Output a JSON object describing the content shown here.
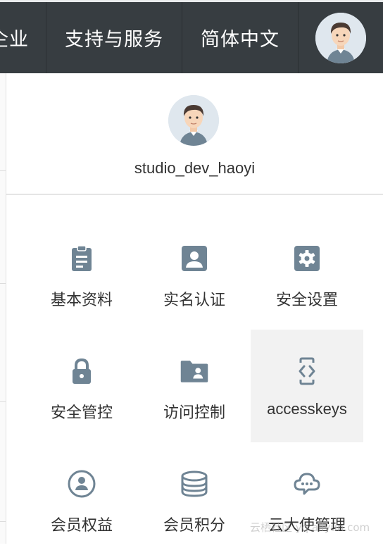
{
  "topbar": {
    "enterprise_label": "企业",
    "support_label": "支持与服务",
    "language_label": "简体中文",
    "avatar_icon": "user-avatar"
  },
  "profile": {
    "username": "studio_dev_haoyi",
    "avatar_icon": "user-avatar"
  },
  "menu": {
    "items": [
      {
        "label": "基本资料",
        "icon": "clipboard-icon"
      },
      {
        "label": "实名认证",
        "icon": "id-card-icon"
      },
      {
        "label": "安全设置",
        "icon": "gear-icon"
      },
      {
        "label": "安全管控",
        "icon": "lock-icon"
      },
      {
        "label": "访问控制",
        "icon": "folder-user-icon"
      },
      {
        "label": "accesskeys",
        "icon": "code-brackets-icon"
      },
      {
        "label": "会员权益",
        "icon": "member-badge-icon"
      },
      {
        "label": "会员积分",
        "icon": "coin-stack-icon"
      },
      {
        "label": "云大使管理",
        "icon": "cloud-chat-icon"
      }
    ],
    "active_item": "accesskeys"
  },
  "colors": {
    "topbar_bg": "#373d41",
    "icon": "#6f8494",
    "text": "#333333",
    "active_bg": "#f2f2f2"
  },
  "watermark": "云栖社区 yq.aliyun.com"
}
